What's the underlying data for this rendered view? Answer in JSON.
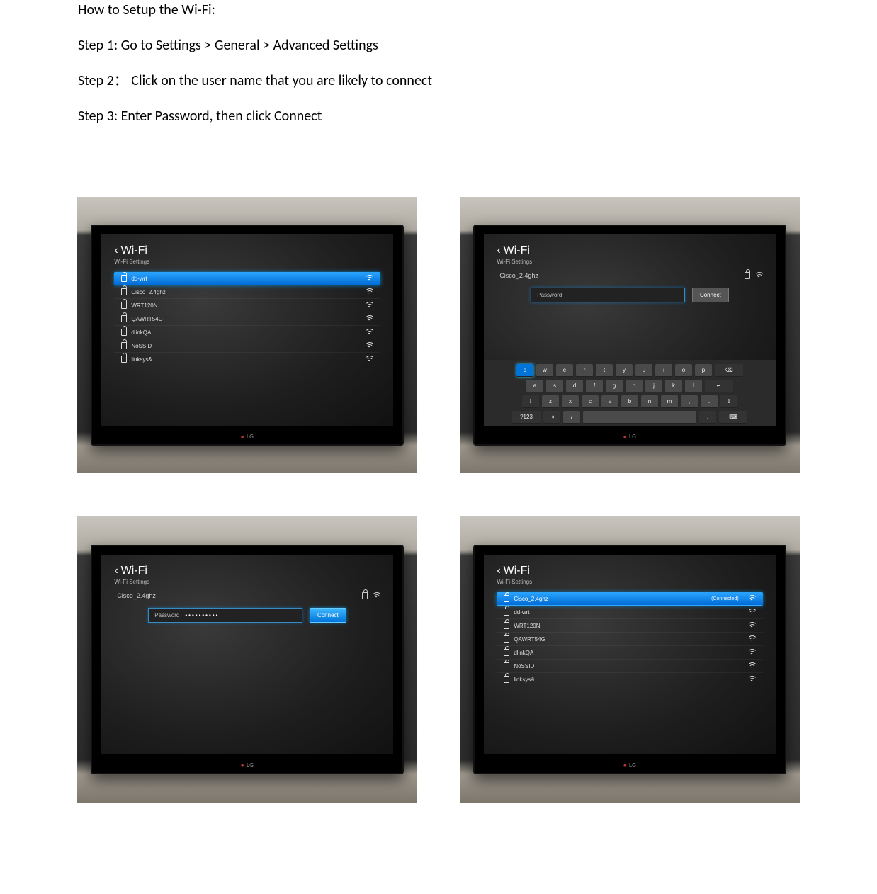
{
  "doc": {
    "title": "How to Setup the Wi-Fi:",
    "step1": "Step 1: Go to Settings > General > Advanced Settings",
    "step2": "Step 2： Click on the user name that you are likely to connect",
    "step3": "Step 3: Enter Password, then click Connect"
  },
  "monitor_brand": "LG",
  "wifi_header": "Wi-Fi",
  "wifi_sub": "Wi-Fi Settings",
  "back_chevron": "‹",
  "password_label": "Password",
  "password_dots": "••••••••••",
  "connect_label": "Connect",
  "connected_label": "(Connected)",
  "screen1_networks": [
    {
      "name": "dd-wrt",
      "selected": true
    },
    {
      "name": "Cisco_2.4ghz",
      "selected": false
    },
    {
      "name": "WRT120N",
      "selected": false
    },
    {
      "name": "QAWRT54G",
      "selected": false
    },
    {
      "name": "dlinkQA",
      "selected": false
    },
    {
      "name": "NoSSID",
      "selected": false
    },
    {
      "name": "linksys&",
      "selected": false
    }
  ],
  "screen2_ssid": "Cisco_2.4ghz",
  "screen3_ssid": "Cisco_2.4ghz",
  "screen4_networks": [
    {
      "name": "Cisco_2.4ghz",
      "selected": true,
      "status": "(Connected)"
    },
    {
      "name": "dd-wrt",
      "selected": false
    },
    {
      "name": "WRT120N",
      "selected": false
    },
    {
      "name": "QAWRT54G",
      "selected": false
    },
    {
      "name": "dlinkQA",
      "selected": false
    },
    {
      "name": "NoSSID",
      "selected": false
    },
    {
      "name": "linksys&",
      "selected": false
    }
  ],
  "keyboard": {
    "row1": [
      "q",
      "w",
      "e",
      "r",
      "t",
      "y",
      "u",
      "i",
      "o",
      "p"
    ],
    "row2": [
      "a",
      "s",
      "d",
      "f",
      "g",
      "h",
      "j",
      "k",
      "l"
    ],
    "row3_shift": "⇧",
    "row3": [
      "z",
      "x",
      "c",
      "v",
      "b",
      "n",
      "m",
      ",",
      "."
    ],
    "row3_shift2": "⇧",
    "sym": "?123",
    "tab": "⇥",
    "slash": "/",
    "backspace": "⌫",
    "enter": "↵",
    "lang": "⌨"
  }
}
